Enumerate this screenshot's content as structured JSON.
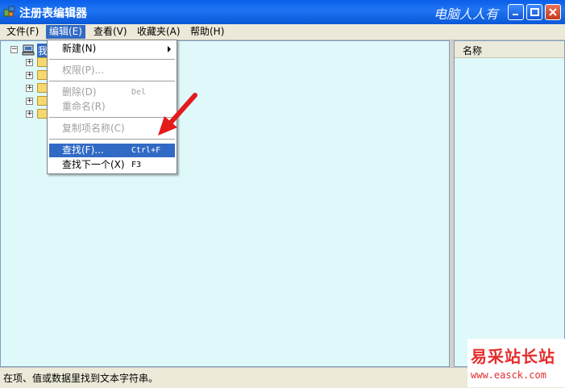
{
  "window": {
    "title": "注册表编辑器",
    "brand_text": "电脑人人有"
  },
  "menubar": {
    "items": [
      "文件(F)",
      "编辑(E)",
      "查看(V)",
      "收藏夹(A)",
      "帮助(H)"
    ],
    "active_index": 1
  },
  "tree": {
    "root_label": "我"
  },
  "list_pane": {
    "column_name": "名称"
  },
  "edit_menu": {
    "items": [
      {
        "label": "新建(N)",
        "shortcut": "",
        "state": "enabled",
        "submenu": true
      },
      {
        "label": "权限(P)...",
        "shortcut": "",
        "state": "disabled"
      },
      {
        "label": "删除(D)",
        "shortcut": "Del",
        "state": "disabled"
      },
      {
        "label": "重命名(R)",
        "shortcut": "",
        "state": "disabled"
      },
      {
        "label": "复制项名称(C)",
        "shortcut": "",
        "state": "disabled"
      },
      {
        "label": "查找(F)...",
        "shortcut": "Ctrl+F",
        "state": "highlighted"
      },
      {
        "label": "查找下一个(X)",
        "shortcut": "F3",
        "state": "enabled"
      }
    ]
  },
  "status": {
    "text": "在项、值或数据里找到文本字符串。"
  },
  "watermark": {
    "chinese": "易采站长站",
    "url": "www.easck.com"
  },
  "colors": {
    "titlebar": "#0a5ee8",
    "menu_highlight": "#316ac5",
    "pane_bg": "#dff8fa",
    "arrow": "#e31b1b",
    "watermark": "#e52d2d"
  }
}
